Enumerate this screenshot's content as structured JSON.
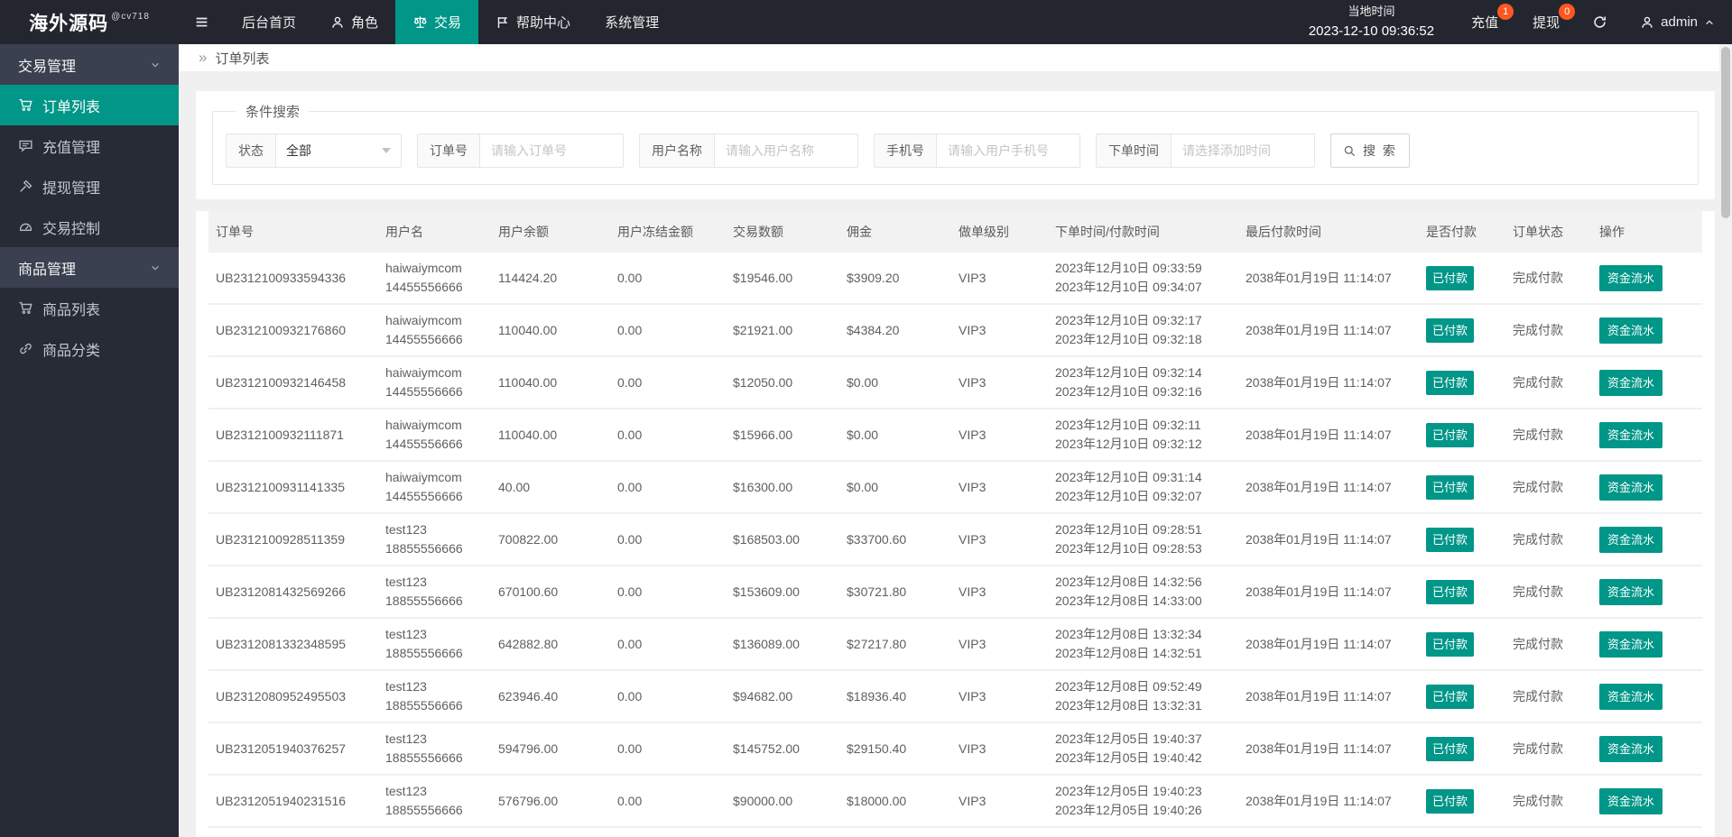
{
  "topbar": {
    "logo": "海外源码",
    "logo_sup": "@cv718",
    "nav": [
      {
        "label": "后台首页"
      },
      {
        "label": "角色"
      },
      {
        "label": "交易"
      },
      {
        "label": "帮助中心"
      },
      {
        "label": "系统管理"
      }
    ],
    "time_label": "当地时间",
    "time_value": "2023-12-10 09:36:52",
    "recharge": {
      "label": "充值",
      "badge": "1"
    },
    "withdraw": {
      "label": "提现",
      "badge": "0"
    },
    "user": "admin"
  },
  "sidebar": {
    "items": [
      {
        "label": "交易管理",
        "type": "group"
      },
      {
        "label": "订单列表",
        "active": true
      },
      {
        "label": "充值管理"
      },
      {
        "label": "提现管理"
      },
      {
        "label": "交易控制"
      },
      {
        "label": "商品管理",
        "type": "group"
      },
      {
        "label": "商品列表"
      },
      {
        "label": "商品分类"
      }
    ]
  },
  "breadcrumb": {
    "current": "订单列表"
  },
  "search": {
    "legend": "条件搜索",
    "status": {
      "label": "状态",
      "value": "全部"
    },
    "order_no": {
      "label": "订单号",
      "placeholder": "请输入订单号"
    },
    "user_name": {
      "label": "用户名称",
      "placeholder": "请输入用户名称"
    },
    "phone": {
      "label": "手机号",
      "placeholder": "请输入用户手机号"
    },
    "order_time": {
      "label": "下单时间",
      "placeholder": "请选择添加时间"
    },
    "button": "搜 索"
  },
  "table": {
    "headers": [
      "订单号",
      "用户名",
      "用户余额",
      "用户冻结金额",
      "交易数额",
      "佣金",
      "做单级别",
      "下单时间/付款时间",
      "最后付款时间",
      "是否付款",
      "订单状态",
      "操作"
    ],
    "rows": [
      {
        "order_no": "UB2312100933594336",
        "user_name": "haiwaiymcom",
        "user_phone": "14455556666",
        "balance": "114424.20",
        "frozen": "0.00",
        "amount": "$19546.00",
        "commission": "$3909.20",
        "level": "VIP3",
        "create_time": "2023年12月10日 09:33:59",
        "pay_time": "2023年12月10日 09:34:07",
        "last_pay_time": "2038年01月19日 11:14:07",
        "paid": "已付款",
        "status": "完成付款",
        "action": "资金流水"
      },
      {
        "order_no": "UB2312100932176860",
        "user_name": "haiwaiymcom",
        "user_phone": "14455556666",
        "balance": "110040.00",
        "frozen": "0.00",
        "amount": "$21921.00",
        "commission": "$4384.20",
        "level": "VIP3",
        "create_time": "2023年12月10日 09:32:17",
        "pay_time": "2023年12月10日 09:32:18",
        "last_pay_time": "2038年01月19日 11:14:07",
        "paid": "已付款",
        "status": "完成付款",
        "action": "资金流水"
      },
      {
        "order_no": "UB2312100932146458",
        "user_name": "haiwaiymcom",
        "user_phone": "14455556666",
        "balance": "110040.00",
        "frozen": "0.00",
        "amount": "$12050.00",
        "commission": "$0.00",
        "level": "VIP3",
        "create_time": "2023年12月10日 09:32:14",
        "pay_time": "2023年12月10日 09:32:16",
        "last_pay_time": "2038年01月19日 11:14:07",
        "paid": "已付款",
        "status": "完成付款",
        "action": "资金流水"
      },
      {
        "order_no": "UB2312100932111871",
        "user_name": "haiwaiymcom",
        "user_phone": "14455556666",
        "balance": "110040.00",
        "frozen": "0.00",
        "amount": "$15966.00",
        "commission": "$0.00",
        "level": "VIP3",
        "create_time": "2023年12月10日 09:32:11",
        "pay_time": "2023年12月10日 09:32:12",
        "last_pay_time": "2038年01月19日 11:14:07",
        "paid": "已付款",
        "status": "完成付款",
        "action": "资金流水"
      },
      {
        "order_no": "UB2312100931141335",
        "user_name": "haiwaiymcom",
        "user_phone": "14455556666",
        "balance": "40.00",
        "frozen": "0.00",
        "amount": "$16300.00",
        "commission": "$0.00",
        "level": "VIP3",
        "create_time": "2023年12月10日 09:31:14",
        "pay_time": "2023年12月10日 09:32:07",
        "last_pay_time": "2038年01月19日 11:14:07",
        "paid": "已付款",
        "status": "完成付款",
        "action": "资金流水"
      },
      {
        "order_no": "UB2312100928511359",
        "user_name": "test123",
        "user_phone": "18855556666",
        "balance": "700822.00",
        "frozen": "0.00",
        "amount": "$168503.00",
        "commission": "$33700.60",
        "level": "VIP3",
        "create_time": "2023年12月10日 09:28:51",
        "pay_time": "2023年12月10日 09:28:53",
        "last_pay_time": "2038年01月19日 11:14:07",
        "paid": "已付款",
        "status": "完成付款",
        "action": "资金流水"
      },
      {
        "order_no": "UB2312081432569266",
        "user_name": "test123",
        "user_phone": "18855556666",
        "balance": "670100.60",
        "frozen": "0.00",
        "amount": "$153609.00",
        "commission": "$30721.80",
        "level": "VIP3",
        "create_time": "2023年12月08日 14:32:56",
        "pay_time": "2023年12月08日 14:33:00",
        "last_pay_time": "2038年01月19日 11:14:07",
        "paid": "已付款",
        "status": "完成付款",
        "action": "资金流水"
      },
      {
        "order_no": "UB2312081332348595",
        "user_name": "test123",
        "user_phone": "18855556666",
        "balance": "642882.80",
        "frozen": "0.00",
        "amount": "$136089.00",
        "commission": "$27217.80",
        "level": "VIP3",
        "create_time": "2023年12月08日 13:32:34",
        "pay_time": "2023年12月08日 14:32:51",
        "last_pay_time": "2038年01月19日 11:14:07",
        "paid": "已付款",
        "status": "完成付款",
        "action": "资金流水"
      },
      {
        "order_no": "UB2312080952495503",
        "user_name": "test123",
        "user_phone": "18855556666",
        "balance": "623946.40",
        "frozen": "0.00",
        "amount": "$94682.00",
        "commission": "$18936.40",
        "level": "VIP3",
        "create_time": "2023年12月08日 09:52:49",
        "pay_time": "2023年12月08日 13:32:31",
        "last_pay_time": "2038年01月19日 11:14:07",
        "paid": "已付款",
        "status": "完成付款",
        "action": "资金流水"
      },
      {
        "order_no": "UB2312051940376257",
        "user_name": "test123",
        "user_phone": "18855556666",
        "balance": "594796.00",
        "frozen": "0.00",
        "amount": "$145752.00",
        "commission": "$29150.40",
        "level": "VIP3",
        "create_time": "2023年12月05日 19:40:37",
        "pay_time": "2023年12月05日 19:40:42",
        "last_pay_time": "2038年01月19日 11:14:07",
        "paid": "已付款",
        "status": "完成付款",
        "action": "资金流水"
      },
      {
        "order_no": "UB2312051940231516",
        "user_name": "test123",
        "user_phone": "18855556666",
        "balance": "576796.00",
        "frozen": "0.00",
        "amount": "$90000.00",
        "commission": "$18000.00",
        "level": "VIP3",
        "create_time": "2023年12月05日 19:40:23",
        "pay_time": "2023年12月05日 19:40:26",
        "last_pay_time": "2038年01月19日 11:14:07",
        "paid": "已付款",
        "status": "完成付款",
        "action": "资金流水"
      }
    ]
  },
  "colors": {
    "accent": "#009688",
    "badge": "#ff5722",
    "topbar_bg": "#23262e",
    "sidebar_bg": "#272b36"
  }
}
